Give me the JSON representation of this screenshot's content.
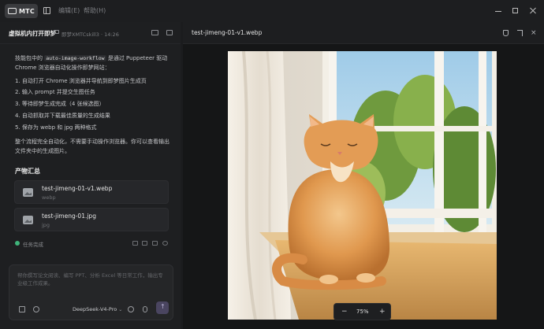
{
  "app": {
    "name": "MTC"
  },
  "menus": [
    "编辑(E)",
    "帮助(H)"
  ],
  "chat": {
    "title": "虚拟机内打开即梦",
    "meta": "即梦XMTCskill3 · 14:26",
    "intro_pre": "技能包中的",
    "intro_code": "auto-image-workflow",
    "intro_post": "是通过 Puppeteer 驱动 Chrome 浏览器自动化操作即梦网站：",
    "steps": [
      "1. 自动打开 Chrome 浏览器并导航到即梦图片生成页",
      "2. 输入 prompt 并提交生图任务",
      "3. 等待即梦生成完成（4 张候选图）",
      "4. 自动抓取并下载最佳质量的生成结果",
      "5. 保存为 webp 和 jpg 两种格式"
    ],
    "summary": "整个流程完全自动化，不需要手动操作浏览器。你可以查看输出文件夹中的生成图片。",
    "artifacts_title": "产物汇总",
    "artifacts": [
      {
        "name": "test-jimeng-01-v1.webp",
        "type": "webp"
      },
      {
        "name": "test-jimeng-01.jpg",
        "type": "jpg"
      }
    ],
    "status": "任务完成"
  },
  "composer": {
    "placeholder": "帮你撰写论文阅读、编写 PPT、分析 Excel 等日常工作，输出专业级工作成果。",
    "model": "DeepSeek-V4-Pro"
  },
  "preview": {
    "filename": "test-jimeng-01-v1.webp",
    "zoom": "75%",
    "zoom_minus": "−",
    "zoom_plus": "+"
  },
  "colors": {
    "accent_green": "#3fb47a",
    "send_button": "#4a4560"
  },
  "icons": [
    "app-logo-icon",
    "sidebar-toggle-icon",
    "minimize-icon",
    "maximize-icon",
    "close-icon",
    "folder-icon",
    "pin-icon",
    "expand-icon",
    "attach-icon",
    "send-icon",
    "mic-icon",
    "image-icon"
  ]
}
